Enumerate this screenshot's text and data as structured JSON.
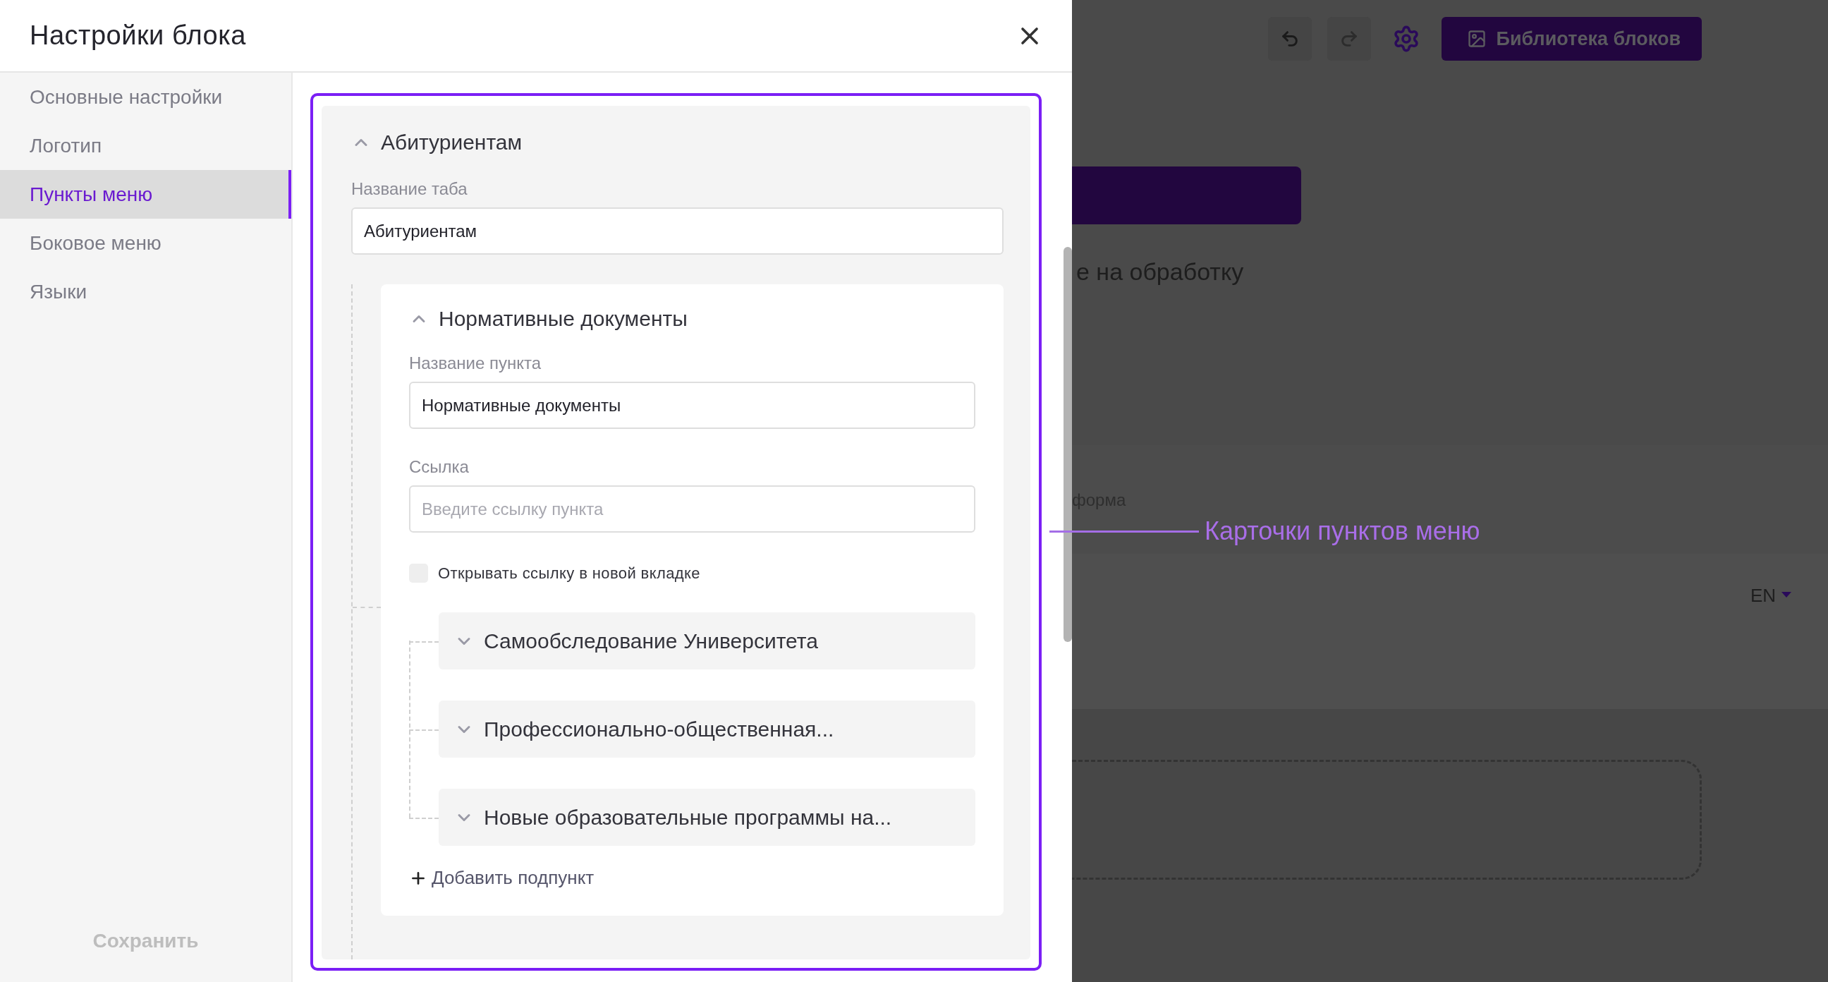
{
  "modal": {
    "title": "Настройки блока",
    "sidebar": {
      "items": [
        {
          "label": "Основные настройки",
          "selected": false
        },
        {
          "label": "Логотип",
          "selected": false
        },
        {
          "label": "Пункты меню",
          "selected": true
        },
        {
          "label": "Боковое меню",
          "selected": false
        },
        {
          "label": "Языки",
          "selected": false
        }
      ],
      "save_button": "Сохранить"
    },
    "tab": {
      "title": "Абитуриентам",
      "expanded": true,
      "name_label": "Название таба",
      "name_value": "Абитуриентам",
      "item": {
        "title": "Нормативные документы",
        "expanded": true,
        "name_label": "Название пункта",
        "name_value": "Нормативные документы",
        "link_label": "Ссылка",
        "link_placeholder": "Введите ссылку пункта",
        "new_tab": {
          "label": "Открывать ссылку в новой вкладке",
          "checked": false
        },
        "subitems": [
          {
            "title": "Самообследование Университета",
            "expanded": false
          },
          {
            "title": "Профессионально-общественная...",
            "expanded": false
          },
          {
            "title": "Новые образовательные программы на...",
            "expanded": false
          }
        ],
        "add_subitem": "Добавить подпункт"
      }
    }
  },
  "background": {
    "library_button": "Библиотека блоков",
    "text_1": "е на обработку",
    "text_2": "форма",
    "language": "EN"
  },
  "annotation": {
    "label": "Карточки пунктов меню"
  }
}
